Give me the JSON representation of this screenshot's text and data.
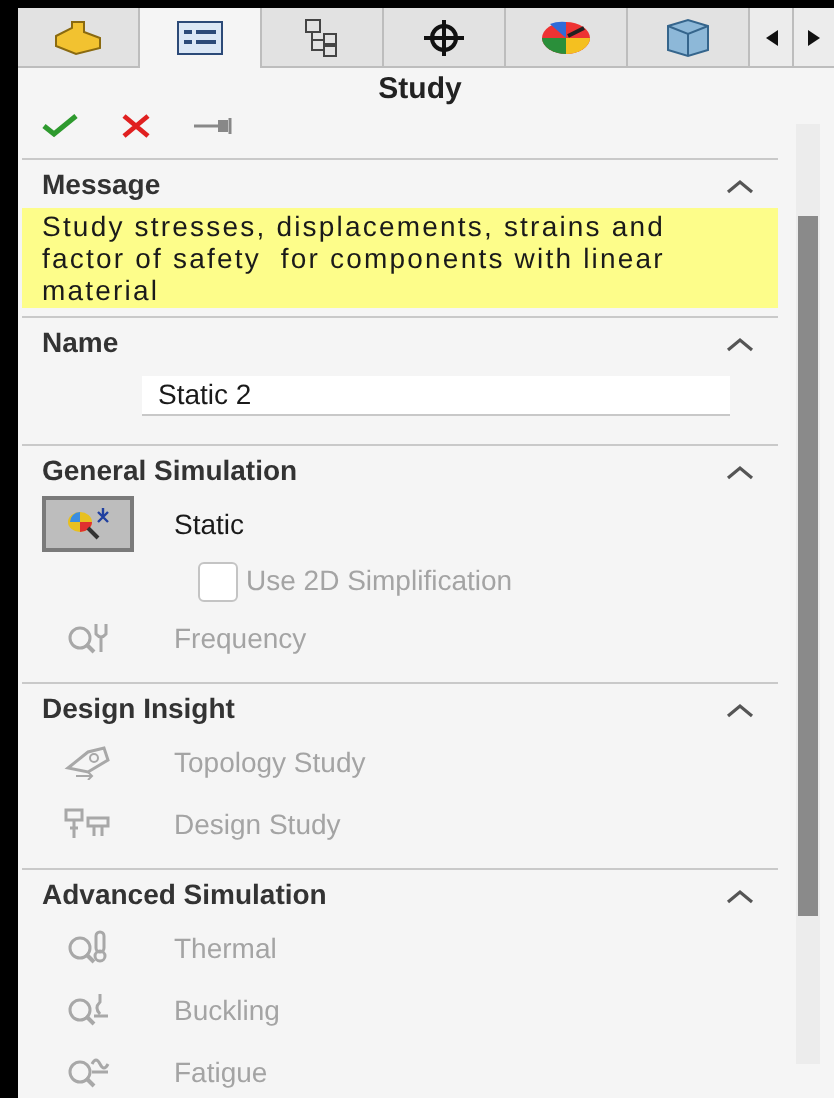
{
  "tabs": [
    {
      "kind": "part",
      "selected": false
    },
    {
      "kind": "property",
      "selected": true
    },
    {
      "kind": "config",
      "selected": false
    },
    {
      "kind": "target",
      "selected": false
    },
    {
      "kind": "display",
      "selected": false
    },
    {
      "kind": "cam",
      "selected": false
    }
  ],
  "title": "Study",
  "sections": [
    {
      "header": "Message",
      "expanded": true,
      "kind": "message",
      "text": "Study stresses, displacements, strains and factor of safety  for components with linear material"
    },
    {
      "header": "Name",
      "expanded": true,
      "kind": "name",
      "value": "Static 2"
    },
    {
      "header": "General Simulation",
      "expanded": true,
      "kind": "list",
      "items": [
        {
          "kind": "study",
          "label": "Static",
          "selected": true,
          "disabled": false
        },
        {
          "kind": "checkbox",
          "label": "Use 2D Simplification",
          "checked": false,
          "disabled": true
        },
        {
          "kind": "study",
          "label": "Frequency",
          "selected": false,
          "disabled": true
        }
      ]
    },
    {
      "header": "Design Insight",
      "expanded": true,
      "kind": "list",
      "items": [
        {
          "kind": "study",
          "label": "Topology Study",
          "selected": false,
          "disabled": true
        },
        {
          "kind": "study",
          "label": "Design Study",
          "selected": false,
          "disabled": true
        }
      ]
    },
    {
      "header": "Advanced Simulation",
      "expanded": true,
      "kind": "list",
      "items": [
        {
          "kind": "study",
          "label": "Thermal",
          "selected": false,
          "disabled": true
        },
        {
          "kind": "study",
          "label": "Buckling",
          "selected": false,
          "disabled": true
        },
        {
          "kind": "study",
          "label": "Fatigue",
          "selected": false,
          "disabled": true
        }
      ]
    }
  ]
}
